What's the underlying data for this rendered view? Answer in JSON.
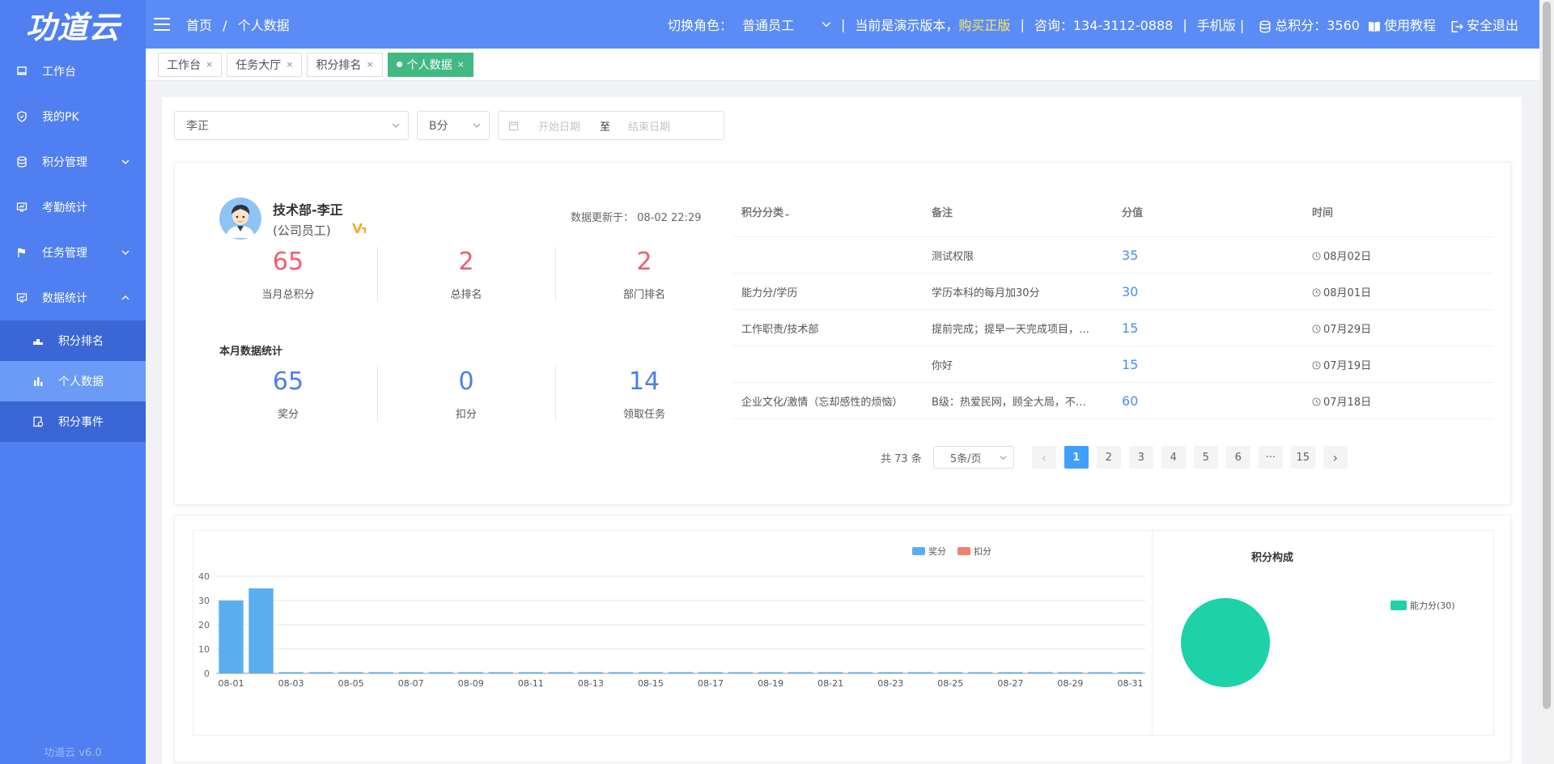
{
  "app": {
    "logo": "功道云",
    "version": "功道云 v6.0"
  },
  "sidebar": {
    "items": [
      {
        "label": "工作台",
        "icon": "monitor-icon"
      },
      {
        "label": "我的PK",
        "icon": "shield-icon"
      },
      {
        "label": "积分管理",
        "icon": "database-icon"
      },
      {
        "label": "考勤统计",
        "icon": "chart-screen-icon"
      },
      {
        "label": "任务管理",
        "icon": "flag-icon"
      },
      {
        "label": "数据统计",
        "icon": "chart-screen-icon"
      }
    ],
    "sub_items": [
      {
        "label": "积分排名",
        "icon": "podium-icon"
      },
      {
        "label": "个人数据",
        "icon": "bar-icon"
      },
      {
        "label": "积分事件",
        "icon": "event-icon"
      }
    ]
  },
  "header": {
    "breadcrumb_home": "首页",
    "breadcrumb_sep": "/",
    "breadcrumb_current": "个人数据",
    "role_label": "切换角色：",
    "role_value": "普通员工",
    "sep": "|",
    "demo_text": "当前是演示版本，",
    "buy_text": "购买正版",
    "consult": "咨询：134-3112-0888",
    "mobile": "手机版 |",
    "total_points": "总积分：3560",
    "tutorial": "使用教程",
    "logout": "安全退出"
  },
  "tabs": [
    {
      "label": "工作台",
      "close": "×"
    },
    {
      "label": "任务大厅",
      "close": "×"
    },
    {
      "label": "积分排名",
      "close": "×"
    },
    {
      "label": "个人数据",
      "close": "×"
    }
  ],
  "filters": {
    "person": "李正",
    "score_type": "B分",
    "start_placeholder": "开始日期",
    "to": "至",
    "end_placeholder": "结束日期"
  },
  "profile": {
    "name": "技术部-李正",
    "role": "(公司员工)",
    "updated": "数据更新于： 08-02 22:29"
  },
  "stats_top": [
    {
      "value": "65",
      "label": "当月总积分"
    },
    {
      "value": "2",
      "label": "总排名"
    },
    {
      "value": "2",
      "label": "部门排名"
    }
  ],
  "month_title": "本月数据统计",
  "stats_month": [
    {
      "value": "65",
      "label": "奖分"
    },
    {
      "value": "0",
      "label": "扣分"
    },
    {
      "value": "14",
      "label": "领取任务"
    }
  ],
  "table": {
    "headers": [
      "积分分类",
      "备注",
      "分值",
      "时间"
    ],
    "sort_mark": "⌄",
    "rows": [
      {
        "category": "",
        "note": "测试权限",
        "score": "35",
        "time": "08月02日"
      },
      {
        "category": "能力分/学历",
        "note": "学历本科的每月加30分",
        "score": "30",
        "time": "08月01日"
      },
      {
        "category": "工作职责/技术部",
        "note": "提前完成；提早一天完成项目，…",
        "score": "15",
        "time": "07月29日"
      },
      {
        "category": "",
        "note": "你好",
        "score": "15",
        "time": "07月19日"
      },
      {
        "category": "企业文化/激情（忘却感性的烦恼）",
        "note": "B级：热爱民网，顾全大局，不…",
        "score": "60",
        "time": "07月18日"
      }
    ]
  },
  "pager": {
    "total": "共 73 条",
    "page_size": "5条/页",
    "prev": "‹",
    "next": "›",
    "pages": [
      "1",
      "2",
      "3",
      "4",
      "5",
      "6",
      "···",
      "15"
    ]
  },
  "chart_data": [
    {
      "type": "bar",
      "title": "",
      "legend": {
        "position": "top-right",
        "items": [
          "奖分",
          "扣分"
        ]
      },
      "colors": {
        "奖分": "#5aaef0",
        "扣分": "#f08070"
      },
      "ylim": [
        0,
        40
      ],
      "yticks": [
        0,
        10,
        20,
        30,
        40
      ],
      "grid": true,
      "categories": [
        "08-01",
        "08-02",
        "08-03",
        "08-04",
        "08-05",
        "08-06",
        "08-07",
        "08-08",
        "08-09",
        "08-10",
        "08-11",
        "08-12",
        "08-13",
        "08-14",
        "08-15",
        "08-16",
        "08-17",
        "08-18",
        "08-19",
        "08-20",
        "08-21",
        "08-22",
        "08-23",
        "08-24",
        "08-25",
        "08-26",
        "08-27",
        "08-28",
        "08-29",
        "08-30",
        "08-31"
      ],
      "tick_labels": [
        "08-01",
        "08-03",
        "08-05",
        "08-07",
        "08-09",
        "08-11",
        "08-13",
        "08-15",
        "08-17",
        "08-19",
        "08-21",
        "08-23",
        "08-25",
        "08-27",
        "08-29",
        "08-31"
      ],
      "series": [
        {
          "name": "奖分",
          "values": [
            30,
            35,
            0,
            0,
            0,
            0,
            0,
            0,
            0,
            0,
            0,
            0,
            0,
            0,
            0,
            0,
            0,
            0,
            0,
            0,
            0,
            0,
            0,
            0,
            0,
            0,
            0,
            0,
            0,
            0,
            0
          ]
        },
        {
          "name": "扣分",
          "values": [
            0,
            0,
            0,
            0,
            0,
            0,
            0,
            0,
            0,
            0,
            0,
            0,
            0,
            0,
            0,
            0,
            0,
            0,
            0,
            0,
            0,
            0,
            0,
            0,
            0,
            0,
            0,
            0,
            0,
            0,
            0
          ]
        }
      ]
    },
    {
      "type": "pie",
      "title": "积分构成",
      "legend": {
        "position": "right"
      },
      "slices": [
        {
          "name": "能力分",
          "value": 30,
          "label": "能力分(30)",
          "color": "#1dd1a8"
        }
      ]
    }
  ]
}
